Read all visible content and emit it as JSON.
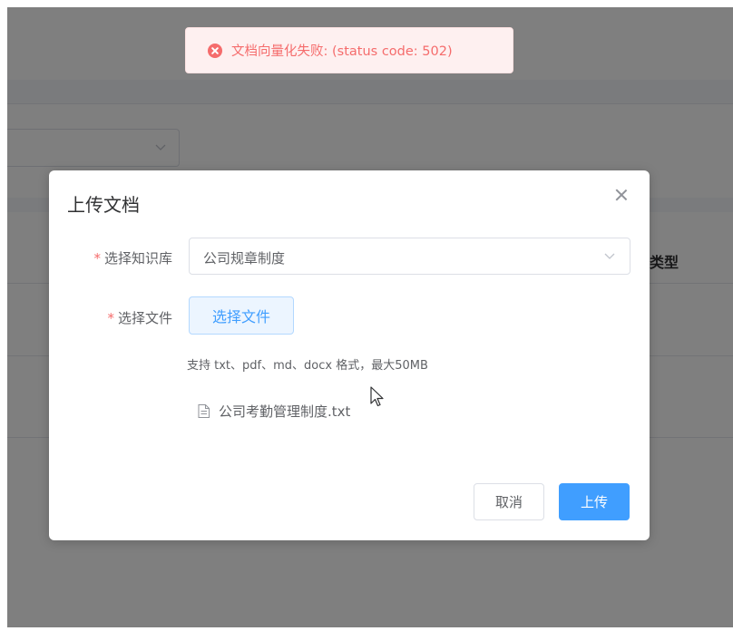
{
  "toast": {
    "icon": "error-circle-icon",
    "message": "文档向量化失败: (status code: 502)",
    "color": "#f56c6c"
  },
  "background": {
    "table_column_type": "类型"
  },
  "dialog": {
    "title": "上传文档",
    "close_icon": "close-icon",
    "knowledge_base": {
      "label": "选择知识库",
      "required_mark": "*",
      "selected": "公司规章制度"
    },
    "file": {
      "label": "选择文件",
      "required_mark": "*",
      "button_label": "选择文件",
      "hint": "支持 txt、pdf、md、docx 格式，最大50MB",
      "selected_files": [
        "公司考勤管理制度.txt"
      ]
    },
    "footer": {
      "cancel_label": "取消",
      "upload_label": "上传"
    }
  },
  "colors": {
    "primary": "#409eff",
    "danger": "#f56c6c"
  }
}
